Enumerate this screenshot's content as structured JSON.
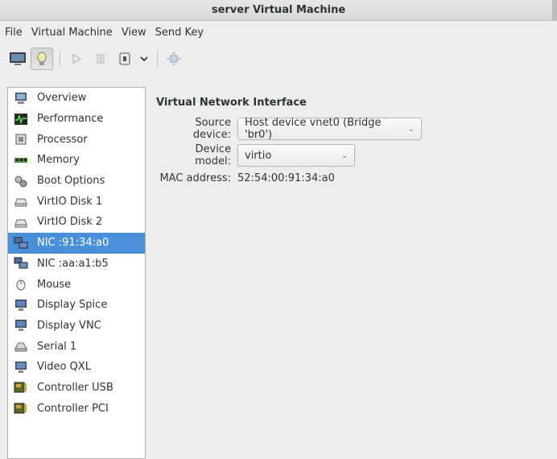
{
  "window": {
    "title": "server Virtual Machine"
  },
  "menu": [
    "File",
    "Virtual Machine",
    "View",
    "Send Key"
  ],
  "toolbar": {
    "buttons": [
      "console-icon",
      "details-icon",
      "run-icon",
      "pause-icon",
      "shutdown-icon",
      "dropdown-icon",
      "fullscreen-icon"
    ]
  },
  "sidebar": {
    "items": [
      {
        "label": "Overview",
        "icon": "overview-icon",
        "selected": false
      },
      {
        "label": "Performance",
        "icon": "performance-icon",
        "selected": false
      },
      {
        "label": "Processor",
        "icon": "processor-icon",
        "selected": false
      },
      {
        "label": "Memory",
        "icon": "memory-icon",
        "selected": false
      },
      {
        "label": "Boot Options",
        "icon": "boot-options-icon",
        "selected": false
      },
      {
        "label": "VirtIO Disk 1",
        "icon": "disk-icon",
        "selected": false
      },
      {
        "label": "VirtIO Disk 2",
        "icon": "disk-icon",
        "selected": false
      },
      {
        "label": "NIC :91:34:a0",
        "icon": "nic-icon",
        "selected": true
      },
      {
        "label": "NIC :aa:a1:b5",
        "icon": "nic-icon",
        "selected": false
      },
      {
        "label": "Mouse",
        "icon": "mouse-icon",
        "selected": false
      },
      {
        "label": "Display Spice",
        "icon": "display-icon",
        "selected": false
      },
      {
        "label": "Display VNC",
        "icon": "display-icon",
        "selected": false
      },
      {
        "label": "Serial 1",
        "icon": "serial-icon",
        "selected": false
      },
      {
        "label": "Video QXL",
        "icon": "video-icon",
        "selected": false
      },
      {
        "label": "Controller USB",
        "icon": "controller-icon",
        "selected": false
      },
      {
        "label": "Controller PCI",
        "icon": "controller-icon",
        "selected": false
      }
    ]
  },
  "details": {
    "section_title": "Virtual Network Interface",
    "source_device_label": "Source device:",
    "source_device_value": "Host device vnet0 (Bridge 'br0')",
    "device_model_label": "Device model:",
    "device_model_value": "virtio",
    "mac_label": "MAC address:",
    "mac_value": "52:54:00:91:34:a0"
  },
  "colors": {
    "selection": "#4a90d9",
    "window_bg": "#ededed"
  }
}
